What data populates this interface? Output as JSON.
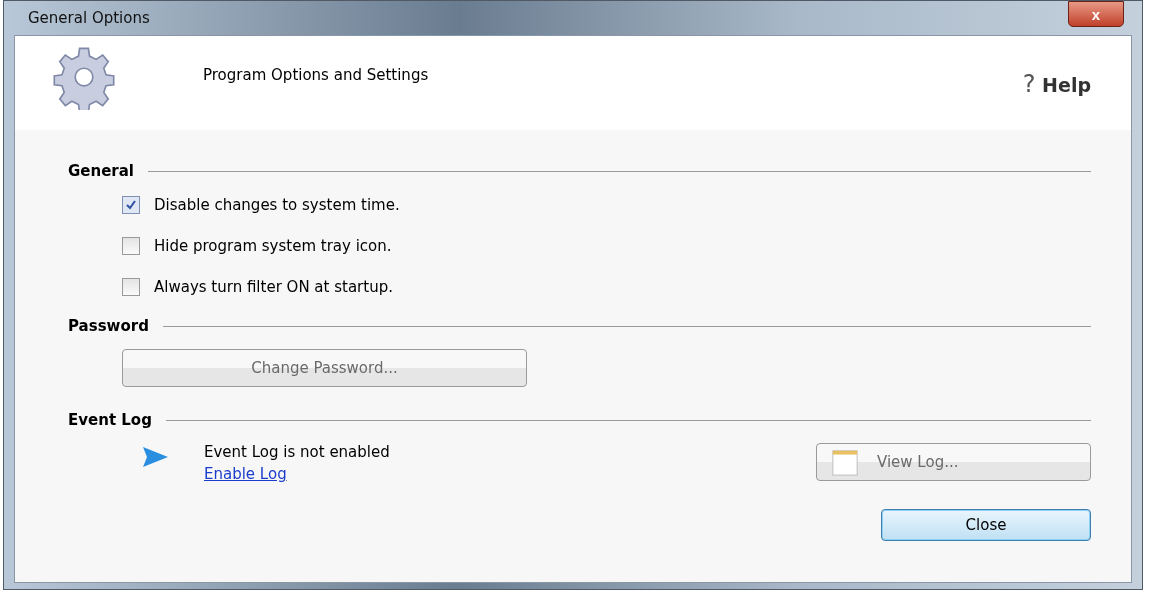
{
  "window": {
    "title": "General Options",
    "close_glyph": "x"
  },
  "header": {
    "title": "Program Options and Settings",
    "help_glyph": "?",
    "help_label": "Help"
  },
  "general": {
    "heading": "General",
    "options": [
      {
        "label": "Disable changes to system time.",
        "checked": true
      },
      {
        "label": "Hide program system tray icon.",
        "checked": false
      },
      {
        "label": "Always turn filter ON at startup.",
        "checked": false
      }
    ]
  },
  "password": {
    "heading": "Password",
    "button": {
      "label": "Change Password...",
      "disabled": true
    }
  },
  "event_log": {
    "heading": "Event Log",
    "status": "Event Log is not enabled",
    "link": "Enable Log",
    "button": {
      "label": "View Log...",
      "disabled": true
    }
  },
  "buttons": [
    {
      "label": "Close"
    }
  ]
}
